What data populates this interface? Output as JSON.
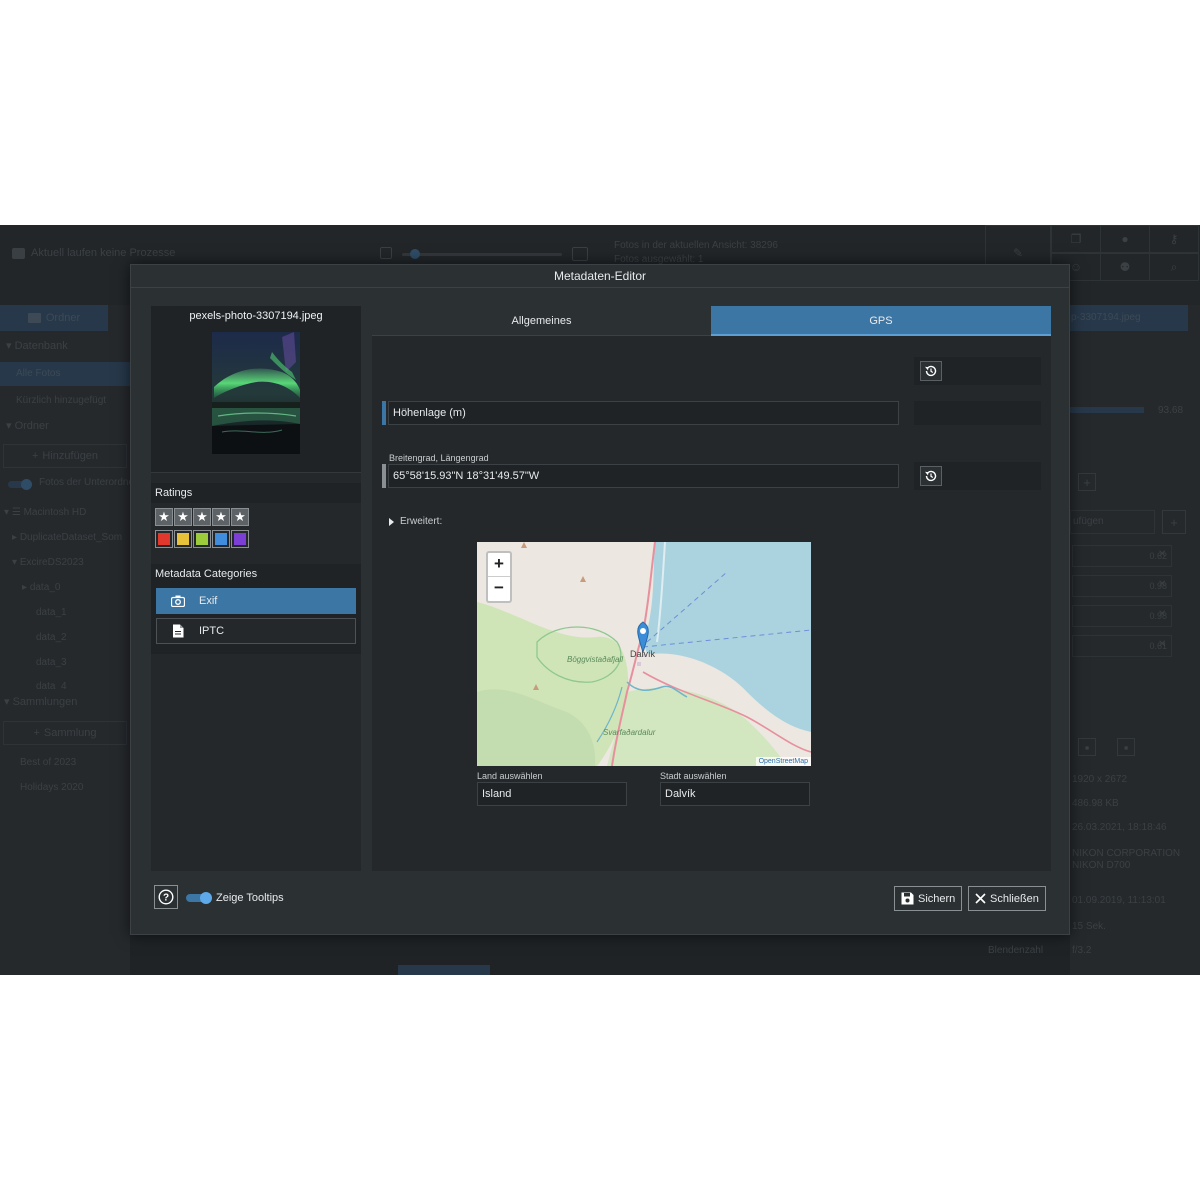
{
  "background": {
    "status": "Aktuell laufen keine Prozesse",
    "info_line1": "Fotos in der aktuellen Ansicht: 38296",
    "info_line2": "Fotos ausgewählt: 1",
    "left_tab": "Ordner",
    "left_items": [
      "Datenbank",
      "Alle Fotos",
      "Kürzlich hinzugefügt",
      "Ordner"
    ],
    "add_button": "Hinzufügen",
    "subfolder_toggle": "Fotos der Unterordner",
    "drive": "Macintosh HD",
    "tree": [
      "DuplicateDataset_Som",
      "ExcireDS2023",
      "data_0",
      "data_1",
      "data_2",
      "data_3",
      "data_4"
    ],
    "collections_head": "Sammlungen",
    "add_collection": "Sammlung",
    "collections": [
      "Best of 2023",
      "Holidays 2020"
    ],
    "right_tab": "p-3307194.jpeg",
    "right_progress_value": "93.68",
    "right_progress_fraction": 0.62,
    "right_input": "ufügen",
    "right_scores": [
      "0.62",
      "0.98",
      "0.98",
      "0.61"
    ],
    "right_meta": [
      "1920 x 2672",
      "486.98 KB",
      "26.03.2021, 18:18:46",
      "NIKON CORPORATION NIKON D700",
      "01.09.2019, 11:13:01",
      "15 Sek.",
      "f/3.2"
    ],
    "blende_label": "Blendenzahl"
  },
  "dialog": {
    "title": "Metadaten-Editor",
    "filename": "pexels-photo-3307194.jpeg",
    "ratings_label": "Ratings",
    "stars": [
      "★",
      "★",
      "★",
      "★",
      "★"
    ],
    "colors": [
      "#e0382c",
      "#e8c13a",
      "#9ccb3b",
      "#3f8ddc",
      "#7b3fd6"
    ],
    "categories_label": "Metadata Categories",
    "categories": [
      {
        "label": "Exif",
        "icon": "camera-icon",
        "active": true
      },
      {
        "label": "IPTC",
        "icon": "document-icon",
        "active": false
      }
    ],
    "tabs": [
      {
        "label": "Allgemeines",
        "active": false
      },
      {
        "label": "GPS",
        "active": true
      }
    ],
    "altitude_placeholder": "Höhenlage (m)",
    "latlon_label": "Breitengrad, Längengrad",
    "latlon_value": "65°58'15.93\"N 18°31'49.57\"W",
    "advanced_label": "Erweitert:",
    "map": {
      "zoom_in": "+",
      "zoom_out": "−",
      "town": "Dalvík",
      "place1": "Böggvistaðafjall",
      "place2": "Svarfaðardalur",
      "attribution": "OpenStreetMap"
    },
    "country_label": "Land auswählen",
    "country_value": "Island",
    "city_label": "Stadt auswählen",
    "city_value": "Dalvík",
    "help_symbol": "?",
    "tooltips_label": "Zeige Tooltips",
    "save_label": "Sichern",
    "close_label": "Schließen"
  }
}
